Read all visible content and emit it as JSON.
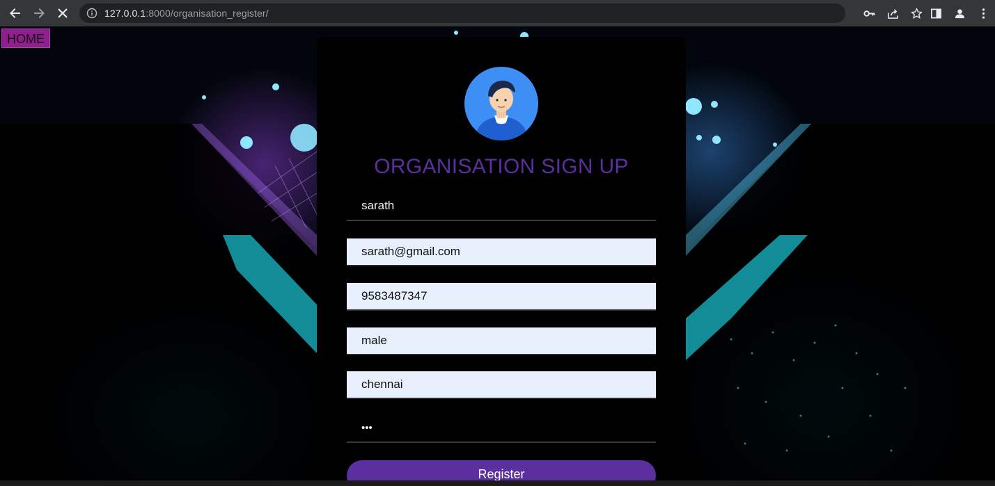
{
  "browser": {
    "url_host": "127.0.0.1",
    "url_rest": ":8000/organisation_register/"
  },
  "page": {
    "home_label": "HOME",
    "title": "ORGANISATION SIGN UP",
    "fields": {
      "name": "sarath",
      "email": "sarath@gmail.com",
      "phone": "9583487347",
      "gender": "male",
      "place": "chennai",
      "password": "•••"
    },
    "register_label": "Register"
  },
  "colors": {
    "accent": "#5b2f9e",
    "home_bg": "#8e1f8c",
    "autofill_bg": "#e8f0fe"
  }
}
